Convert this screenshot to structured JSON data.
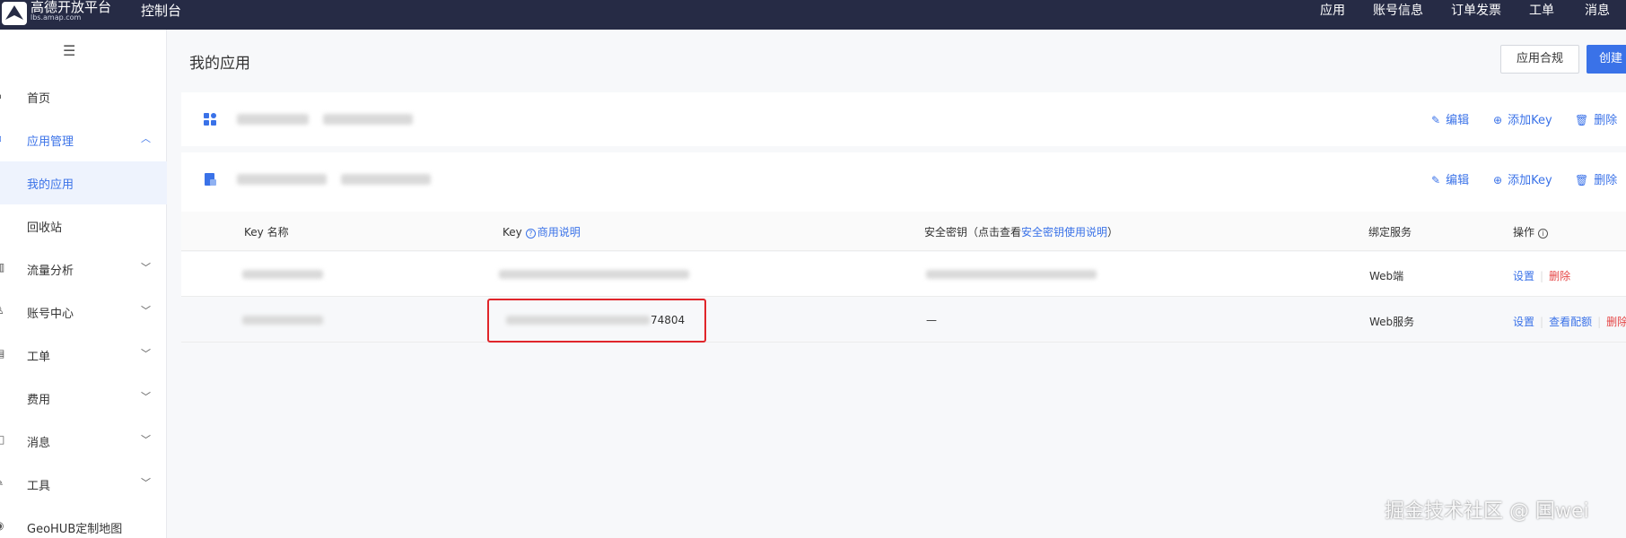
{
  "topbar": {
    "logo_title": "高德开放平台",
    "logo_sub": "lbs.amap.com",
    "console": "控制台",
    "nav": [
      "应用",
      "账号信息",
      "订单发票",
      "工单",
      "消息"
    ]
  },
  "sidebar": {
    "toggle": "☰",
    "items": [
      {
        "label": "首页",
        "icon": "home-icon"
      },
      {
        "label": "应用管理",
        "icon": "app-icon",
        "expanded": true
      },
      {
        "label": "流量分析",
        "icon": "chart-icon"
      },
      {
        "label": "账号中心",
        "icon": "user-icon"
      },
      {
        "label": "工单",
        "icon": "ticket-icon"
      },
      {
        "label": "费用",
        "icon": "fee-icon"
      },
      {
        "label": "消息",
        "icon": "message-icon"
      },
      {
        "label": "工具",
        "icon": "tool-icon"
      },
      {
        "label": "GeoHUB定制地图",
        "icon": "map-icon"
      }
    ],
    "sub_items": [
      "我的应用",
      "回收站"
    ]
  },
  "main": {
    "title": "我的应用",
    "compliance_button": "应用合规",
    "create_button": "创建",
    "card_actions": {
      "edit": "编辑",
      "add_key": "添加Key",
      "delete": "删除"
    },
    "table": {
      "headers": {
        "key_name": "Key 名称",
        "key": "Key",
        "commercial_note": "商用说明",
        "secret_prefix": "安全密钥（点击查看",
        "secret_link": "安全密钥使用说明",
        "secret_suffix": "）",
        "service": "绑定服务",
        "actions": "操作"
      },
      "rows": [
        {
          "key_suffix": "",
          "secret": "",
          "service": "Web端",
          "ops": [
            "设置",
            "删除"
          ]
        },
        {
          "key_suffix": "74804",
          "secret": "—",
          "service": "Web服务",
          "ops": [
            "设置",
            "查看配额",
            "删除"
          ]
        }
      ]
    }
  },
  "watermark": "掘金技术社区 @ 国wei",
  "colors": {
    "topbar": "#262b45",
    "accent": "#3a72e8",
    "danger": "#e54545",
    "highlight": "#e0262b"
  }
}
